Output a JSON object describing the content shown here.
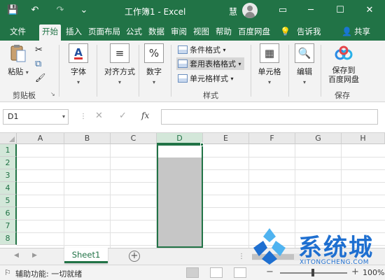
{
  "titlebar": {
    "title": "工作簿1 - Excel",
    "user": "慧",
    "save_icon": "💾",
    "undo_icon": "↶",
    "redo_icon": "↷",
    "qat_more_icon": "⌄",
    "ribbon_display_icon": "▭",
    "minimize_icon": "─",
    "maximize_icon": "☐",
    "close_icon": "✕"
  },
  "tabs": [
    {
      "label": "文件"
    },
    {
      "label": "开始"
    },
    {
      "label": "插入"
    },
    {
      "label": "页面布局"
    },
    {
      "label": "公式"
    },
    {
      "label": "数据"
    },
    {
      "label": "审阅"
    },
    {
      "label": "视图"
    },
    {
      "label": "帮助"
    },
    {
      "label": "百度网盘"
    }
  ],
  "tell_me": {
    "icon": "💡",
    "label": "告诉我"
  },
  "share": {
    "icon": "👤",
    "label": "共享"
  },
  "ribbon": {
    "clipboard": {
      "paste": "粘贴",
      "group": "剪贴板",
      "cut_icon": "✂",
      "copy_icon": "⧉",
      "painter_icon": "🖌",
      "launcher": "↘"
    },
    "font": {
      "label": "字体",
      "icon": "A"
    },
    "align": {
      "label": "对齐方式",
      "icon": "≡"
    },
    "number": {
      "label": "数字",
      "icon": "%"
    },
    "styles": {
      "conditional": "条件格式",
      "table": "套用表格格式",
      "cell_styles": "单元格样式",
      "group": "样式"
    },
    "cells": {
      "label": "单元格",
      "icon": "▦"
    },
    "editing": {
      "label": "编辑",
      "icon": "🔍"
    },
    "save": {
      "label_line1": "保存到",
      "label_line2": "百度网盘",
      "group": "保存"
    },
    "dropdown": "▾"
  },
  "formula_bar": {
    "name_box": "D1",
    "cancel_icon": "✕",
    "enter_icon": "✓",
    "fx_icon": "fx",
    "formula": ""
  },
  "grid": {
    "columns": [
      "A",
      "B",
      "C",
      "D",
      "E",
      "F",
      "G",
      "H"
    ],
    "rows": [
      "1",
      "2",
      "3",
      "4",
      "5",
      "6",
      "7",
      "8"
    ],
    "selected_column": "D"
  },
  "sheets": {
    "tabs": [
      "Sheet1"
    ],
    "active": "Sheet1",
    "add_icon": "+",
    "prev_icon": "◀",
    "next_icon": "▶",
    "split_icon": "⋮"
  },
  "status": {
    "accessibility_icon": "⚐",
    "accessibility": "辅助功能: 一切就绪",
    "zoom": "100%",
    "zoom_minus": "−",
    "zoom_plus": "+"
  },
  "watermark": {
    "text": "系统城",
    "sub": "XITONGCHENG.COM",
    "colors": {
      "blue": "#1e6fd0",
      "light_blue": "#4fb3f0"
    }
  },
  "colors": {
    "accent": "#217346",
    "ribbon_bg": "#f3f3f3",
    "selection_fill": "#c6c6c6"
  }
}
